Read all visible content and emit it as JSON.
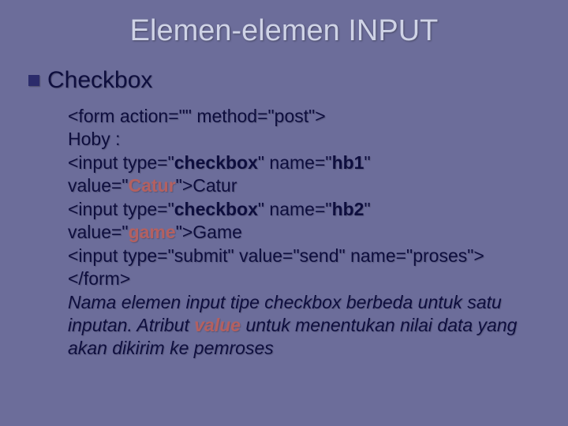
{
  "title": "Elemen-elemen INPUT",
  "heading": "Checkbox",
  "code": {
    "line1_a": "<form action=\"\" method=\"post\">",
    "line2": "Hoby :",
    "line3_a": "<input type=\"",
    "line3_b": "checkbox",
    "line3_c": "\" name=\"",
    "line3_d": "hb1",
    "line3_e": "\" value=\"",
    "line3_f": "Catur",
    "line3_g": "\">Catur",
    "line4_a": "<input type=\"",
    "line4_b": "checkbox",
    "line4_c": "\" name=\"",
    "line4_d": "hb2",
    "line4_e": "\"",
    "line5_a": "value=\"",
    "line5_b": "game",
    "line5_c": "\">Game",
    "line6": "<input type=\"submit\" value=\"send\" name=\"proses\">",
    "line7": "</form>",
    "note_a": "Nama elemen input tipe checkbox berbeda untuk satu inputan. Atribut ",
    "note_b": "value",
    "note_c": " untuk menentukan nilai data yang akan dikirim ke pemroses"
  }
}
